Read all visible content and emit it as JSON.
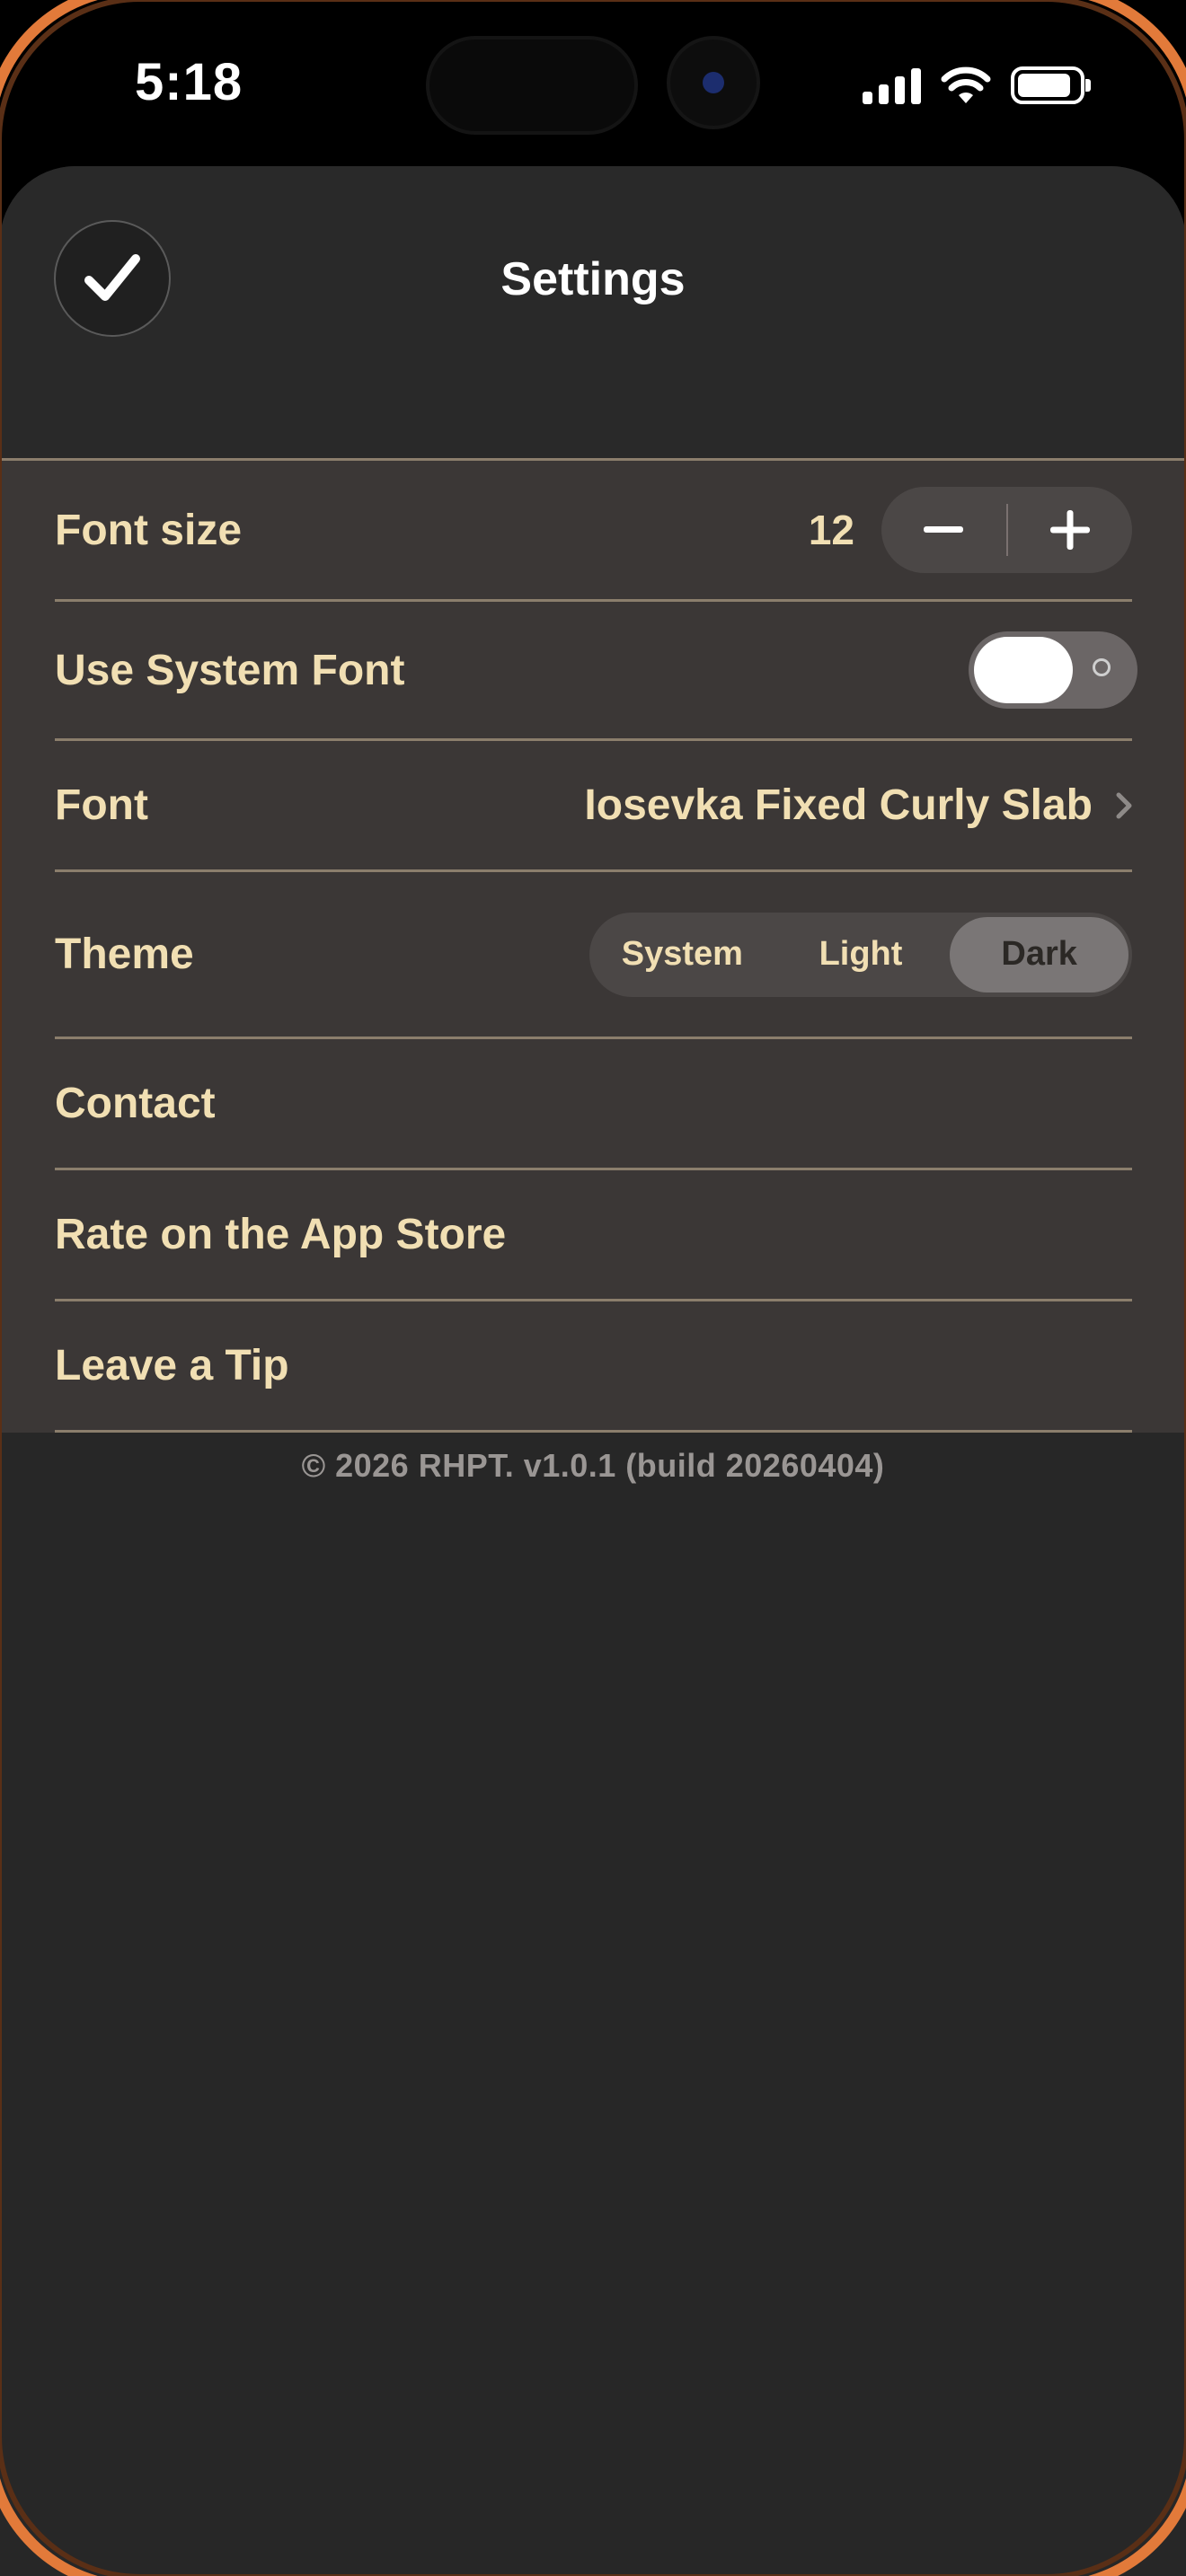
{
  "status_bar": {
    "time": "5:18",
    "icons": [
      "signal-icon",
      "wifi-icon",
      "battery-icon"
    ]
  },
  "header": {
    "title": "Settings",
    "done_icon": "checkmark-icon"
  },
  "settings": {
    "font_size": {
      "label": "Font size",
      "value": "12",
      "decrement_icon": "minus-icon",
      "increment_icon": "plus-icon"
    },
    "system_font": {
      "label": "Use System Font",
      "enabled": false
    },
    "font": {
      "label": "Font",
      "value": "Iosevka Fixed Curly Slab",
      "icon": "chevron-right-icon"
    },
    "theme": {
      "label": "Theme",
      "options": [
        "System",
        "Light",
        "Dark"
      ],
      "selected": "Dark"
    },
    "contact": {
      "label": "Contact"
    },
    "rate": {
      "label": "Rate on the App Store"
    },
    "tip": {
      "label": "Leave a Tip"
    }
  },
  "footer": {
    "text": "© 2026 RHPT. v1.0.1 (build 20260404)"
  },
  "colors": {
    "accent_text": "#f1dfb3",
    "sheet_background": "#272727",
    "list_background": "#3b3736",
    "separator": "#8b7e6c",
    "device_frame": "#e27a3a"
  }
}
